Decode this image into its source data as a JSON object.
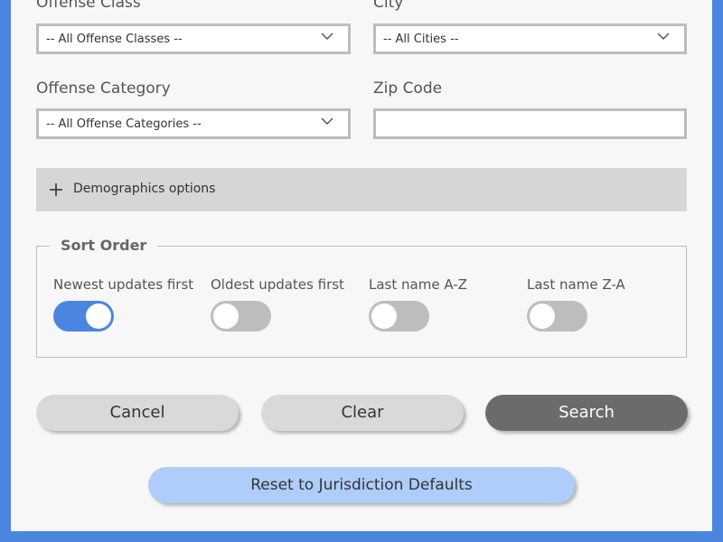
{
  "fields": {
    "offense_class": {
      "label": "Offense Class",
      "value": "-- All Offense Classes --"
    },
    "city": {
      "label": "City",
      "value": "-- All Cities --"
    },
    "offense_category": {
      "label": "Offense Category",
      "value": "-- All Offense Categories --"
    },
    "zip_code": {
      "label": "Zip Code",
      "value": ""
    }
  },
  "demographics": {
    "label": "Demographics options",
    "icon": "plus-icon"
  },
  "sort_order": {
    "legend": "Sort Order",
    "options": [
      {
        "label": "Newest updates first",
        "on": true
      },
      {
        "label": "Oldest updates first",
        "on": false
      },
      {
        "label": "Last name A-Z",
        "on": false
      },
      {
        "label": "Last name Z-A",
        "on": false
      }
    ]
  },
  "buttons": {
    "cancel": "Cancel",
    "clear": "Clear",
    "search": "Search",
    "reset": "Reset to Jurisdiction Defaults"
  },
  "colors": {
    "accent": "#4a86e0",
    "reset_button": "#aecdfb",
    "search_button": "#6b6b6b"
  }
}
